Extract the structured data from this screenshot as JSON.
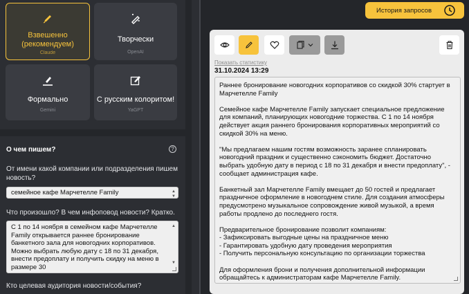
{
  "styles": [
    {
      "label": "Взвешенно (рекомендуем)",
      "sub": "Claude",
      "icon": "pencil-icon",
      "selected": true
    },
    {
      "label": "Творчески",
      "sub": "OpenAI",
      "icon": "magic-pen-icon",
      "selected": false
    },
    {
      "label": "Формально",
      "sub": "Gemini",
      "icon": "pen-line-icon",
      "selected": false
    },
    {
      "label": "С русским колоритом!",
      "sub": "YaGPT",
      "icon": "edit-box-icon",
      "selected": false
    }
  ],
  "form": {
    "title": "О чем пишем?",
    "help": "?",
    "q1": "От имени какой компании или подразделения пишем новость?",
    "a1": "семейное кафе Марчетелле Family",
    "q2": "Что произошло? В чем инфоповод новости? Кратко.",
    "a2": "С 1 по 14 ноября в семейном кафе Марчетелле Family открывается раннее бронирование банкетного зала для новогодних корпоративов. Можно выбрать любую дату с 18 по 31 декабря, внести предоплату и получить скидку на меню в размере 30",
    "q3": "Кто целевая аудитория новости/события?"
  },
  "header": {
    "history_label": "История запросов"
  },
  "toolbar": {
    "show_stats": "Показать статистику",
    "date": "31.10.2024 13:29"
  },
  "article": {
    "p1": "Раннее бронирование новогодних корпоративов со скидкой 30% стартует в Марчетелле Family",
    "p2": "Семейное кафе Марчетелле Family запускает специальное предложение для компаний, планирующих новогодние торжества. С 1 по 14 ноября действует акция раннего бронирования корпоративных мероприятий со скидкой 30% на меню.",
    "p3": "\"Мы предлагаем нашим гостям возможность заранее спланировать новогодний праздник и существенно сэкономить бюджет. Достаточно выбрать удобную дату в период с 18 по 31 декабря и внести предоплату\", - сообщает администрация кафе.",
    "p4": "Банкетный зал Марчетелле Family вмещает до 50 гостей и предлагает праздничное оформление в новогоднем стиле. Для создания атмосферы предусмотрено музыкальное сопровождение живой музыкой, а время работы продлено до последнего гостя.",
    "p5": "Предварительное бронирование позволит компаниям:",
    "p5a": "- Зафиксировать выгодные цены на праздничное меню",
    "p5b": "- Гарантировать удобную дату проведения мероприятия",
    "p5c": "- Получить персональную консультацию по организации торжества",
    "p6": "Для оформления брони и получения дополнительной информации обращайтесь к администраторам кафе Марчетелле Family."
  },
  "colors": {
    "accent": "#f7c33c",
    "dark": "#24262a",
    "panel": "#2c2e33",
    "card": "#3a3c42"
  }
}
